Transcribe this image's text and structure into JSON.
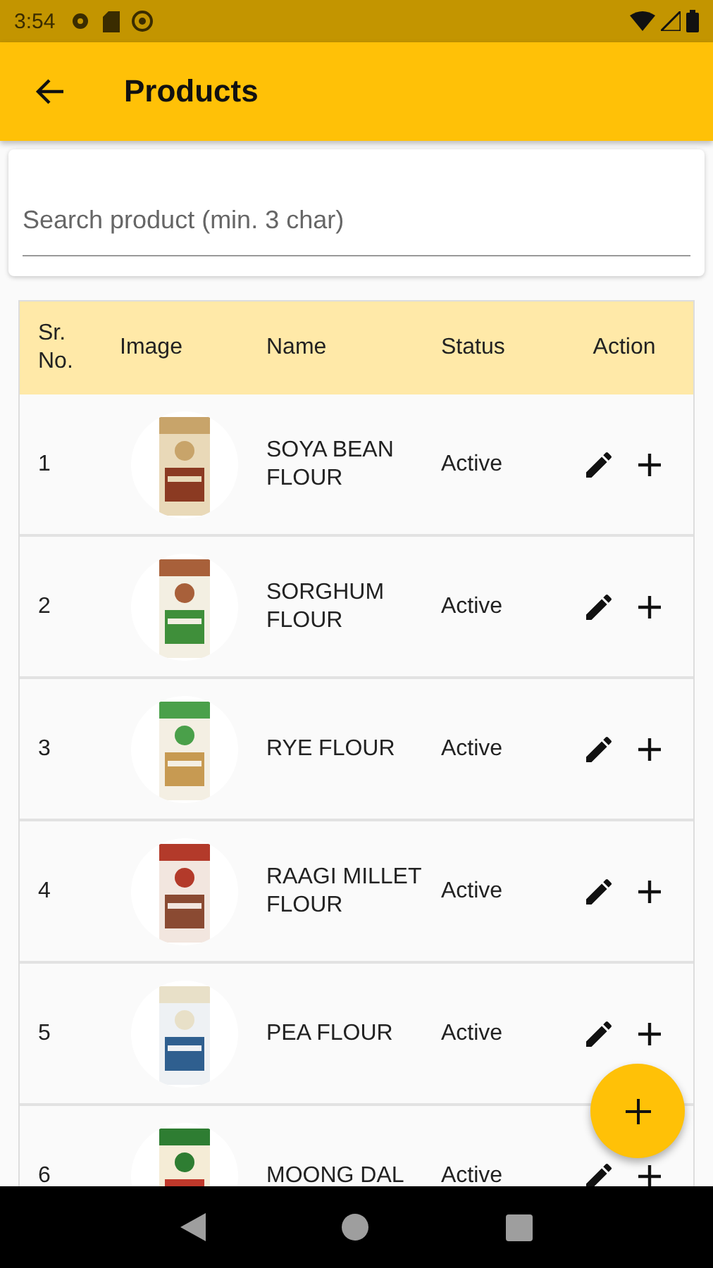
{
  "status_bar": {
    "time": "3:54"
  },
  "app_bar": {
    "title": "Products"
  },
  "search": {
    "placeholder": "Search product (min. 3 char)"
  },
  "table": {
    "columns": [
      "Sr.\nNo.",
      "Image",
      "Name",
      "Status",
      "Action"
    ],
    "rows": [
      {
        "sr": "1",
        "name": "SOYA BEAN FLOUR",
        "status": "Active"
      },
      {
        "sr": "2",
        "name": "SORGHUM FLOUR",
        "status": "Active"
      },
      {
        "sr": "3",
        "name": "RYE FLOUR",
        "status": "Active"
      },
      {
        "sr": "4",
        "name": "RAAGI MILLET FLOUR",
        "status": "Active"
      },
      {
        "sr": "5",
        "name": "PEA FLOUR",
        "status": "Active"
      },
      {
        "sr": "6",
        "name": "MOONG DAL",
        "status": "Active"
      }
    ]
  }
}
